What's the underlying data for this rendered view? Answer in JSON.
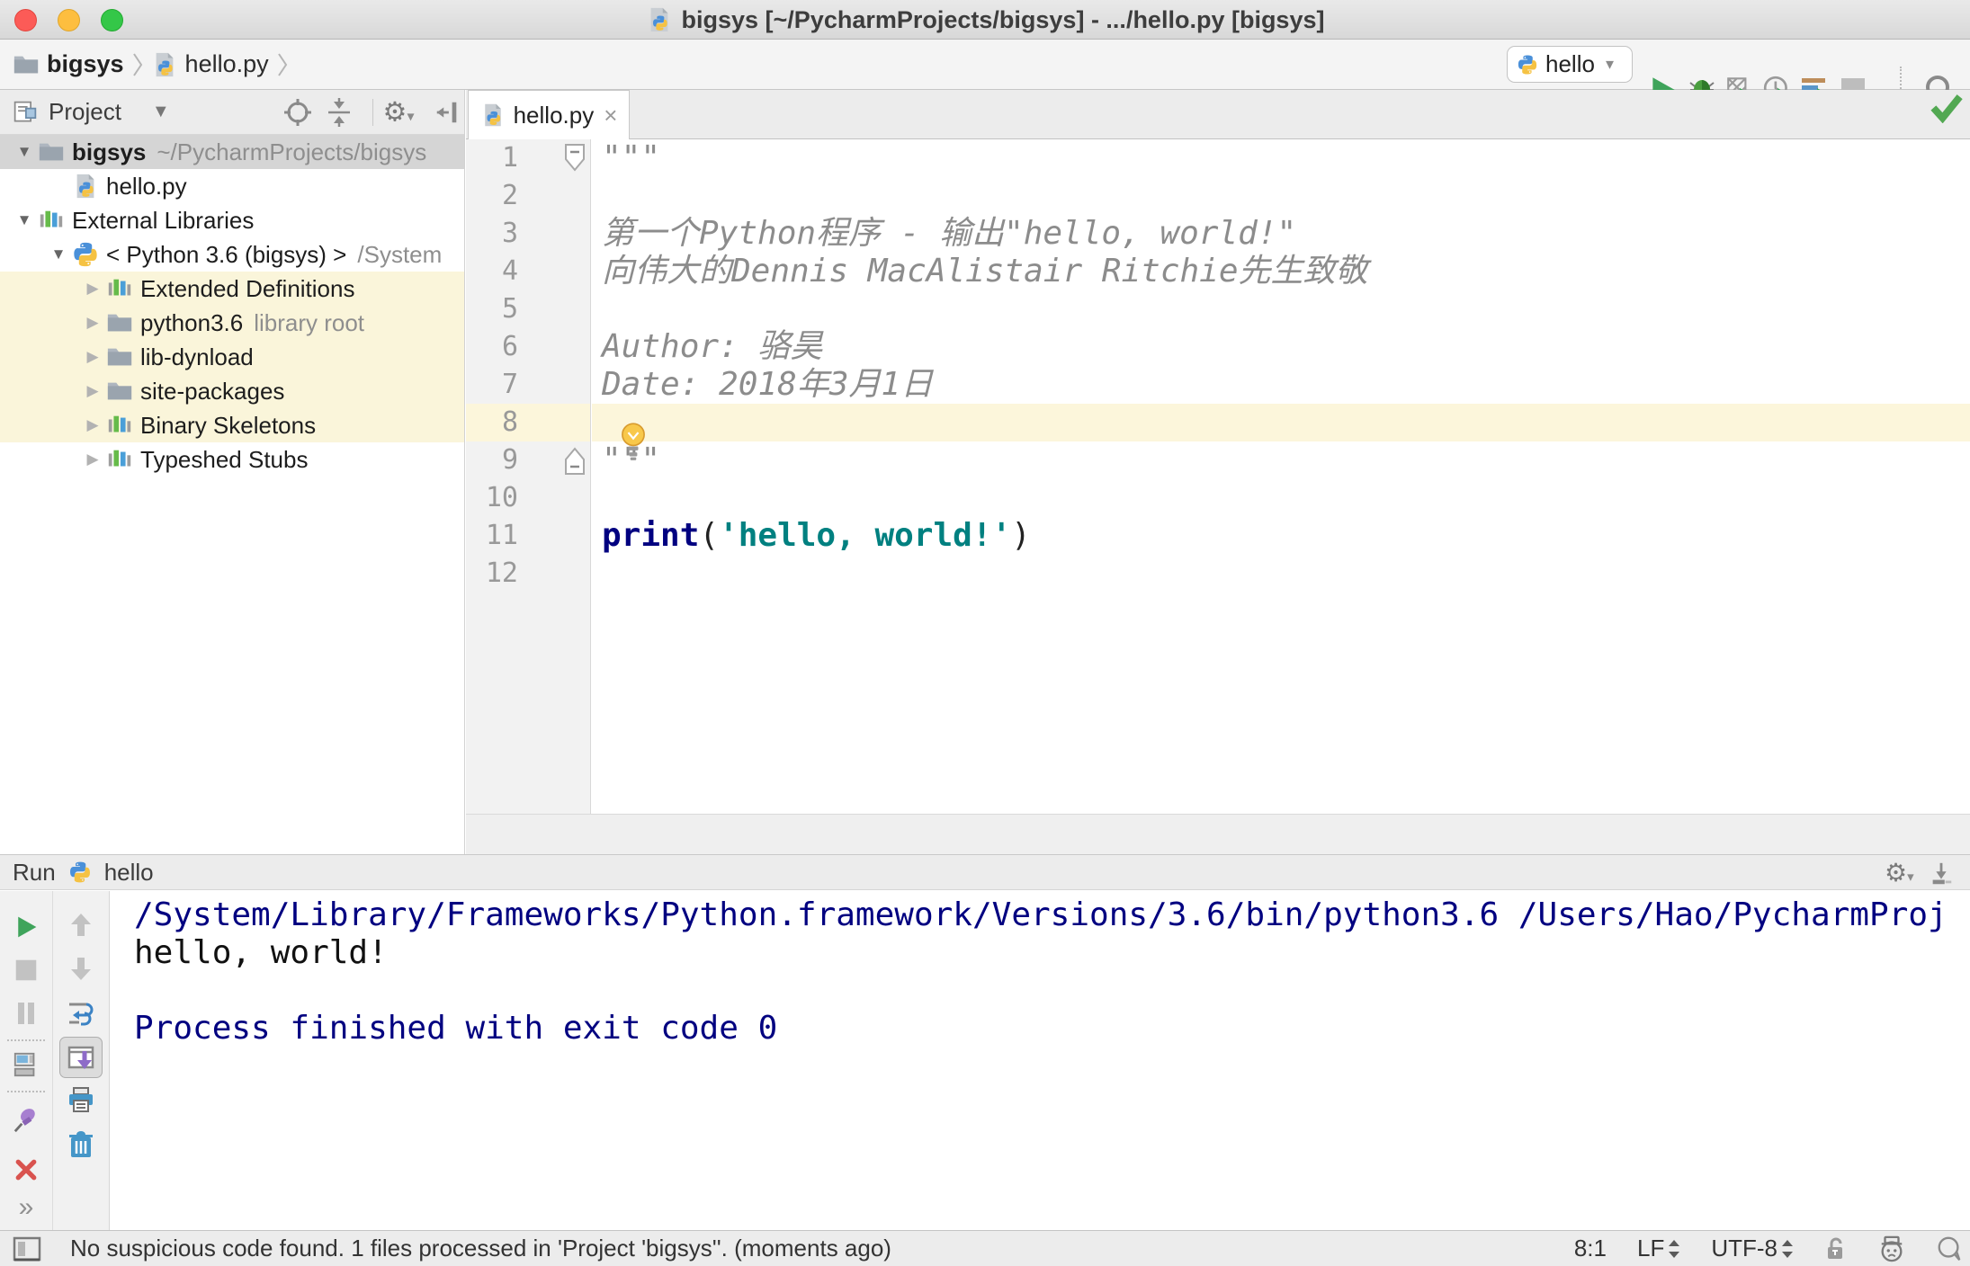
{
  "window": {
    "title": "bigsys [~/PycharmProjects/bigsys] - .../hello.py [bigsys]"
  },
  "breadcrumbs": {
    "project": "bigsys",
    "file": "hello.py"
  },
  "toolbar": {
    "run_config": "hello"
  },
  "project_panel": {
    "title": "Project",
    "tree": [
      {
        "label": "bigsys",
        "suffix": "~/PycharmProjects/bigsys",
        "icon": "folder",
        "arrow": "down",
        "level": 0,
        "bold": true,
        "selected": true
      },
      {
        "label": "hello.py",
        "icon": "pyfile",
        "arrow": "none",
        "level": 1
      },
      {
        "label": "External Libraries",
        "icon": "library",
        "arrow": "down",
        "level": 0
      },
      {
        "label": "< Python 3.6 (bigsys) >",
        "suffix": "/System",
        "icon": "python",
        "arrow": "down",
        "level": 1
      },
      {
        "label": "Extended Definitions",
        "icon": "library",
        "arrow": "right",
        "level": 2,
        "highlight": true
      },
      {
        "label": "python3.6",
        "suffix": "library root",
        "icon": "folder",
        "arrow": "right",
        "level": 2,
        "highlight": true
      },
      {
        "label": "lib-dynload",
        "icon": "folder",
        "arrow": "right",
        "level": 2,
        "highlight": true
      },
      {
        "label": "site-packages",
        "icon": "folder",
        "arrow": "right",
        "level": 2,
        "highlight": true
      },
      {
        "label": "Binary Skeletons",
        "icon": "library",
        "arrow": "right",
        "level": 2,
        "highlight": true
      },
      {
        "label": "Typeshed Stubs",
        "icon": "library",
        "arrow": "right",
        "level": 2
      }
    ]
  },
  "editor": {
    "tab": "hello.py",
    "caret_line": 8,
    "lines": [
      {
        "n": 1,
        "fold": "start",
        "tokens": [
          {
            "text": "\"\"\"",
            "style": "doc"
          }
        ]
      },
      {
        "n": 2,
        "tokens": []
      },
      {
        "n": 3,
        "tokens": [
          {
            "text": "第一个Python程序 - 输出\"hello, world!\"",
            "style": "doc"
          }
        ]
      },
      {
        "n": 4,
        "tokens": [
          {
            "text": "向伟大的Dennis MacAlistair Ritchie先生致敬",
            "style": "doc"
          }
        ]
      },
      {
        "n": 5,
        "tokens": []
      },
      {
        "n": 6,
        "tokens": [
          {
            "text": "Author: 骆昊",
            "style": "doc"
          }
        ]
      },
      {
        "n": 7,
        "tokens": [
          {
            "text": "Date: 2018年3月1日",
            "style": "doc"
          }
        ]
      },
      {
        "n": 8,
        "tokens": []
      },
      {
        "n": 9,
        "fold": "end",
        "tokens": [
          {
            "text": "\"\"\"",
            "style": "doc"
          }
        ]
      },
      {
        "n": 10,
        "tokens": []
      },
      {
        "n": 11,
        "tokens": [
          {
            "text": "print",
            "style": "keyword"
          },
          {
            "text": "(",
            "style": "plain"
          },
          {
            "text": "'hello, world!'",
            "style": "string"
          },
          {
            "text": ")",
            "style": "plain"
          }
        ]
      },
      {
        "n": 12,
        "tokens": []
      }
    ]
  },
  "run_panel": {
    "label": "Run",
    "config": "hello",
    "console": [
      {
        "text": "/System/Library/Frameworks/Python.framework/Versions/3.6/bin/python3.6 /Users/Hao/PycharmProj",
        "style": "system"
      },
      {
        "text": "hello, world!",
        "style": "stdout"
      },
      {
        "text": "",
        "style": "stdout"
      },
      {
        "text": "Process finished with exit code 0",
        "style": "system"
      }
    ]
  },
  "status_bar": {
    "message": "No suspicious code found. 1 files processed in 'Project 'bigsys''. (moments ago)",
    "position": "8:1",
    "line_separator": "LF",
    "encoding": "UTF-8"
  },
  "colors": {
    "keyword": "#000080",
    "string": "#008080",
    "docstring": "#8c8c8c",
    "console_system": "#000080",
    "console_stdout": "#111111",
    "caret_line": "#fcf6db",
    "tree_highlight": "#faf5da",
    "tree_selection": "#d5d5d5",
    "run_green": "#3fa45b",
    "inspection_ok": "#52a852"
  }
}
